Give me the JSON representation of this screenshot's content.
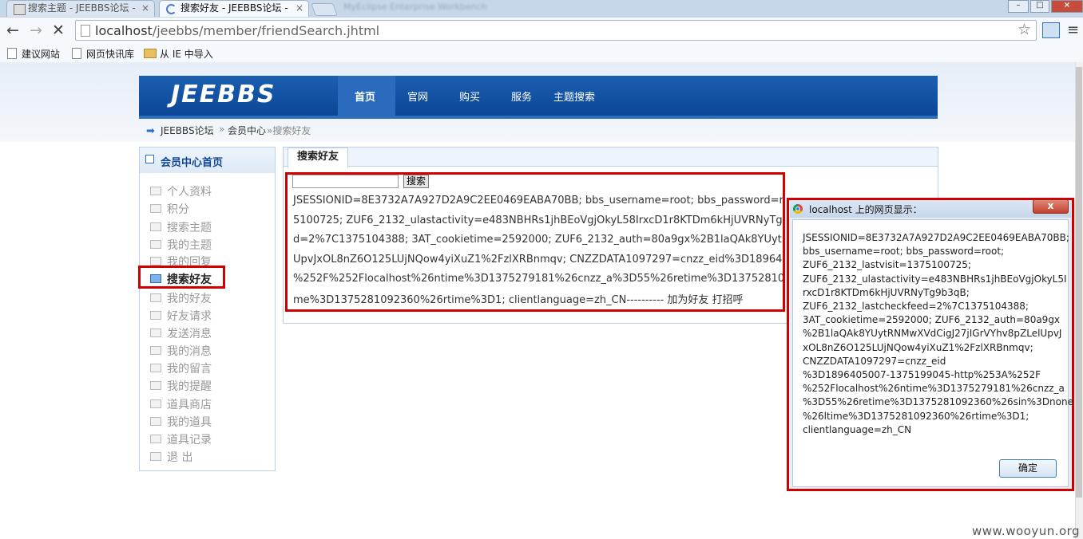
{
  "browser": {
    "tabs": [
      {
        "label": "搜索主题 - JEEBBS论坛 -",
        "active": false
      },
      {
        "label": "搜索好友 - JEEBBS论坛 -",
        "active": true
      }
    ],
    "url_host": "localhost",
    "url_path": "/jeebbs/member/friendSearch.jhtml",
    "bookmarks": [
      "建议网站",
      "网页快讯库",
      "从 IE 中导入"
    ]
  },
  "site": {
    "logo": "JEEBBS",
    "nav": [
      "首页",
      "官网",
      "购买",
      "服务",
      "主题搜索"
    ],
    "breadcrumb": [
      "JEEBBS论坛",
      "»",
      "会员中心",
      "»搜索好友"
    ]
  },
  "sidebar": {
    "title": "会员中心首页",
    "items": [
      "个人资料",
      "积分",
      "搜索主题",
      "我的主题",
      "我的回复",
      "搜索好友",
      "我的好友",
      "好友请求",
      "发送消息",
      "我的消息",
      "我的留言",
      "我的提醒",
      "道具商店",
      "我的道具",
      "道具记录",
      "退 出"
    ],
    "active_index": 5
  },
  "main": {
    "tab": "搜索好友",
    "search_button": "搜索",
    "result_lines": [
      "JSESSIONID=8E3732A7A927D2A9C2EE0469EABA70BB; bbs_username=root; bbs_password=root",
      "5100725; ZUF6_2132_ulastactivity=e483NBHRs1jhBEoVgjOkyL58IrxcD1r8KTDm6kHjUVRNyTg9b3c",
      "d=2%7C1375104388; 3AT_cookietime=2592000; ZUF6_2132_auth=80a9gx%2B1laQAk8YUytRNM",
      "UpvJxOL8nZ6O125LUjNQow4yiXuZ1%2FzlXRBnmqv; CNZZDATA1097297=cnzz_eid%3D1896405007",
      "%252F%252Flocalhost%26ntime%3D1375279181%26cnzz_a%3D55%26retime%3D1375281092",
      "me%3D1375281092360%26rtime%3D1; clientlanguage=zh_CN---------- 加为好友 打招呼"
    ]
  },
  "dialog": {
    "title": "localhost 上的网页显示：",
    "message_lines": [
      "JSESSIONID=8E3732A7A927D2A9C2EE0469EABA70BB;",
      "bbs_username=root; bbs_password=root;",
      "ZUF6_2132_lastvisit=1375100725;",
      "ZUF6_2132_ulastactivity=e483NBHRs1jhBEoVgjOkyL5I",
      "rxcD1r8KTDm6kHjUVRNyTg9b3qB;",
      "ZUF6_2132_lastcheckfeed=2%7C1375104388;",
      "3AT_cookietime=2592000; ZUF6_2132_auth=80a9gx",
      "%2B1laQAk8YUytRNMwXVdCigJ27jIGrVYhv8pZLelUpvJ",
      "xOL8nZ6O125LUjNQow4yiXuZ1%2FzlXRBnmqv;",
      "CNZZDATA1097297=cnzz_eid",
      "%3D1896405007-1375199045-http%253A%252F",
      "%252Flocalhost%26ntime%3D1375279181%26cnzz_a",
      "%3D55%26retime%3D1375281092360%26sin%3Dnone",
      "%26ltime%3D1375281092360%26rtime%3D1;",
      "clientlanguage=zh_CN"
    ],
    "ok_label": "确定",
    "close_label": "x"
  },
  "watermark": "www.wooyun.org"
}
